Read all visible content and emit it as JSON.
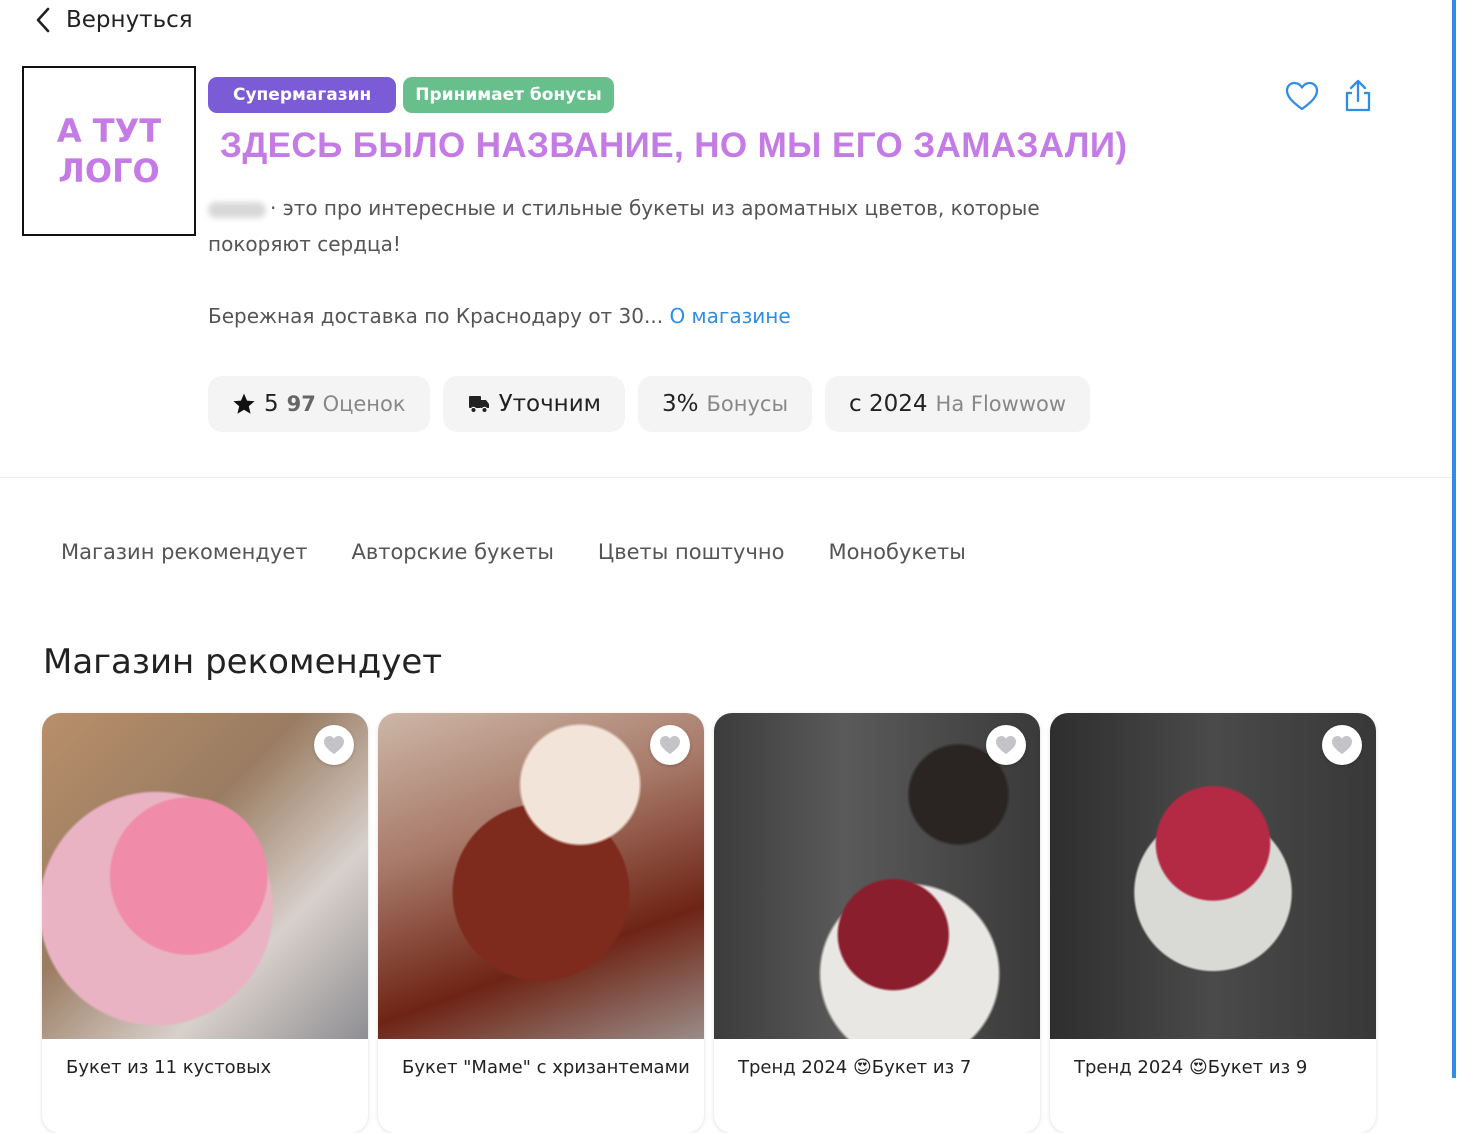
{
  "nav": {
    "back_label": "Вернуться"
  },
  "logo": {
    "text": "А ТУТ\nЛОГО"
  },
  "badges": {
    "super": "Супермагазин",
    "bonus": "Принимает бонусы"
  },
  "store": {
    "title": "ЗДЕСЬ БЫЛО НАЗВАНИЕ, НО МЫ ЕГО ЗАМАЗАЛИ)",
    "description": "· это про интересные и стильные букеты из ароматных цветов, которые покоряют сердца!",
    "delivery": "Бережная доставка по Краснодару от 30...",
    "about_link": "О магазине"
  },
  "stats": {
    "rating_value": "5",
    "rating_count": "97",
    "rating_label": "Оценок",
    "delivery_value": "Уточним",
    "bonus_value": "3%",
    "bonus_label": "Бонусы",
    "since_value": "с 2024",
    "since_label": "На Flowwow"
  },
  "tabs": [
    "Магазин рекомендует",
    "Авторские букеты",
    "Цветы поштучно",
    "Монобукеты"
  ],
  "section": {
    "title": "Магазин рекомендует"
  },
  "products": [
    {
      "title": "Букет из 11 кустовых"
    },
    {
      "title": "Букет \"Маме\" с хризантемами"
    },
    {
      "title": "Тренд 2024 😍Букет из 7"
    },
    {
      "title": "Тренд 2024 😍Букет из 9"
    }
  ],
  "colors": {
    "accent_purple": "#7b5bd6",
    "accent_green": "#67c08c",
    "title_color": "#c57be6",
    "link_blue": "#2f8de4"
  },
  "icons": [
    "chevron-left-icon",
    "heart-icon",
    "share-icon",
    "star-icon",
    "delivery-truck-icon"
  ]
}
